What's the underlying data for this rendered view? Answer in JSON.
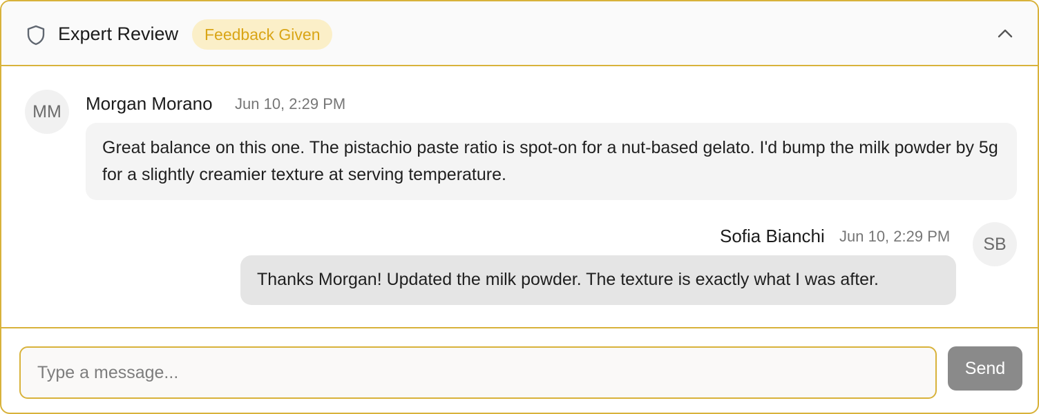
{
  "header": {
    "icon": "shield-icon",
    "title": "Expert Review",
    "status_badge": "Feedback Given",
    "collapse_icon": "chevron-up-icon"
  },
  "messages": [
    {
      "initials": "MM",
      "author": "Morgan Morano",
      "time": "Jun 10, 2:29 PM",
      "text": "Great balance on this one. The pistachio paste ratio is spot-on for a nut-based gelato. I'd bump the milk powder by 5g for a slightly creamier texture at serving temperature."
    },
    {
      "initials": "SB",
      "author": "Sofia Bianchi",
      "time": "Jun 10, 2:29 PM",
      "text": "Thanks Morgan! Updated the milk powder. The texture is exactly what I was after."
    }
  ],
  "composer": {
    "placeholder": "Type a message...",
    "value": "",
    "send_label": "Send"
  },
  "colors": {
    "accent_border": "#d8b23a",
    "badge_bg": "#fbefc8",
    "badge_text": "#d9a516",
    "send_button": "#8a8a8a"
  }
}
